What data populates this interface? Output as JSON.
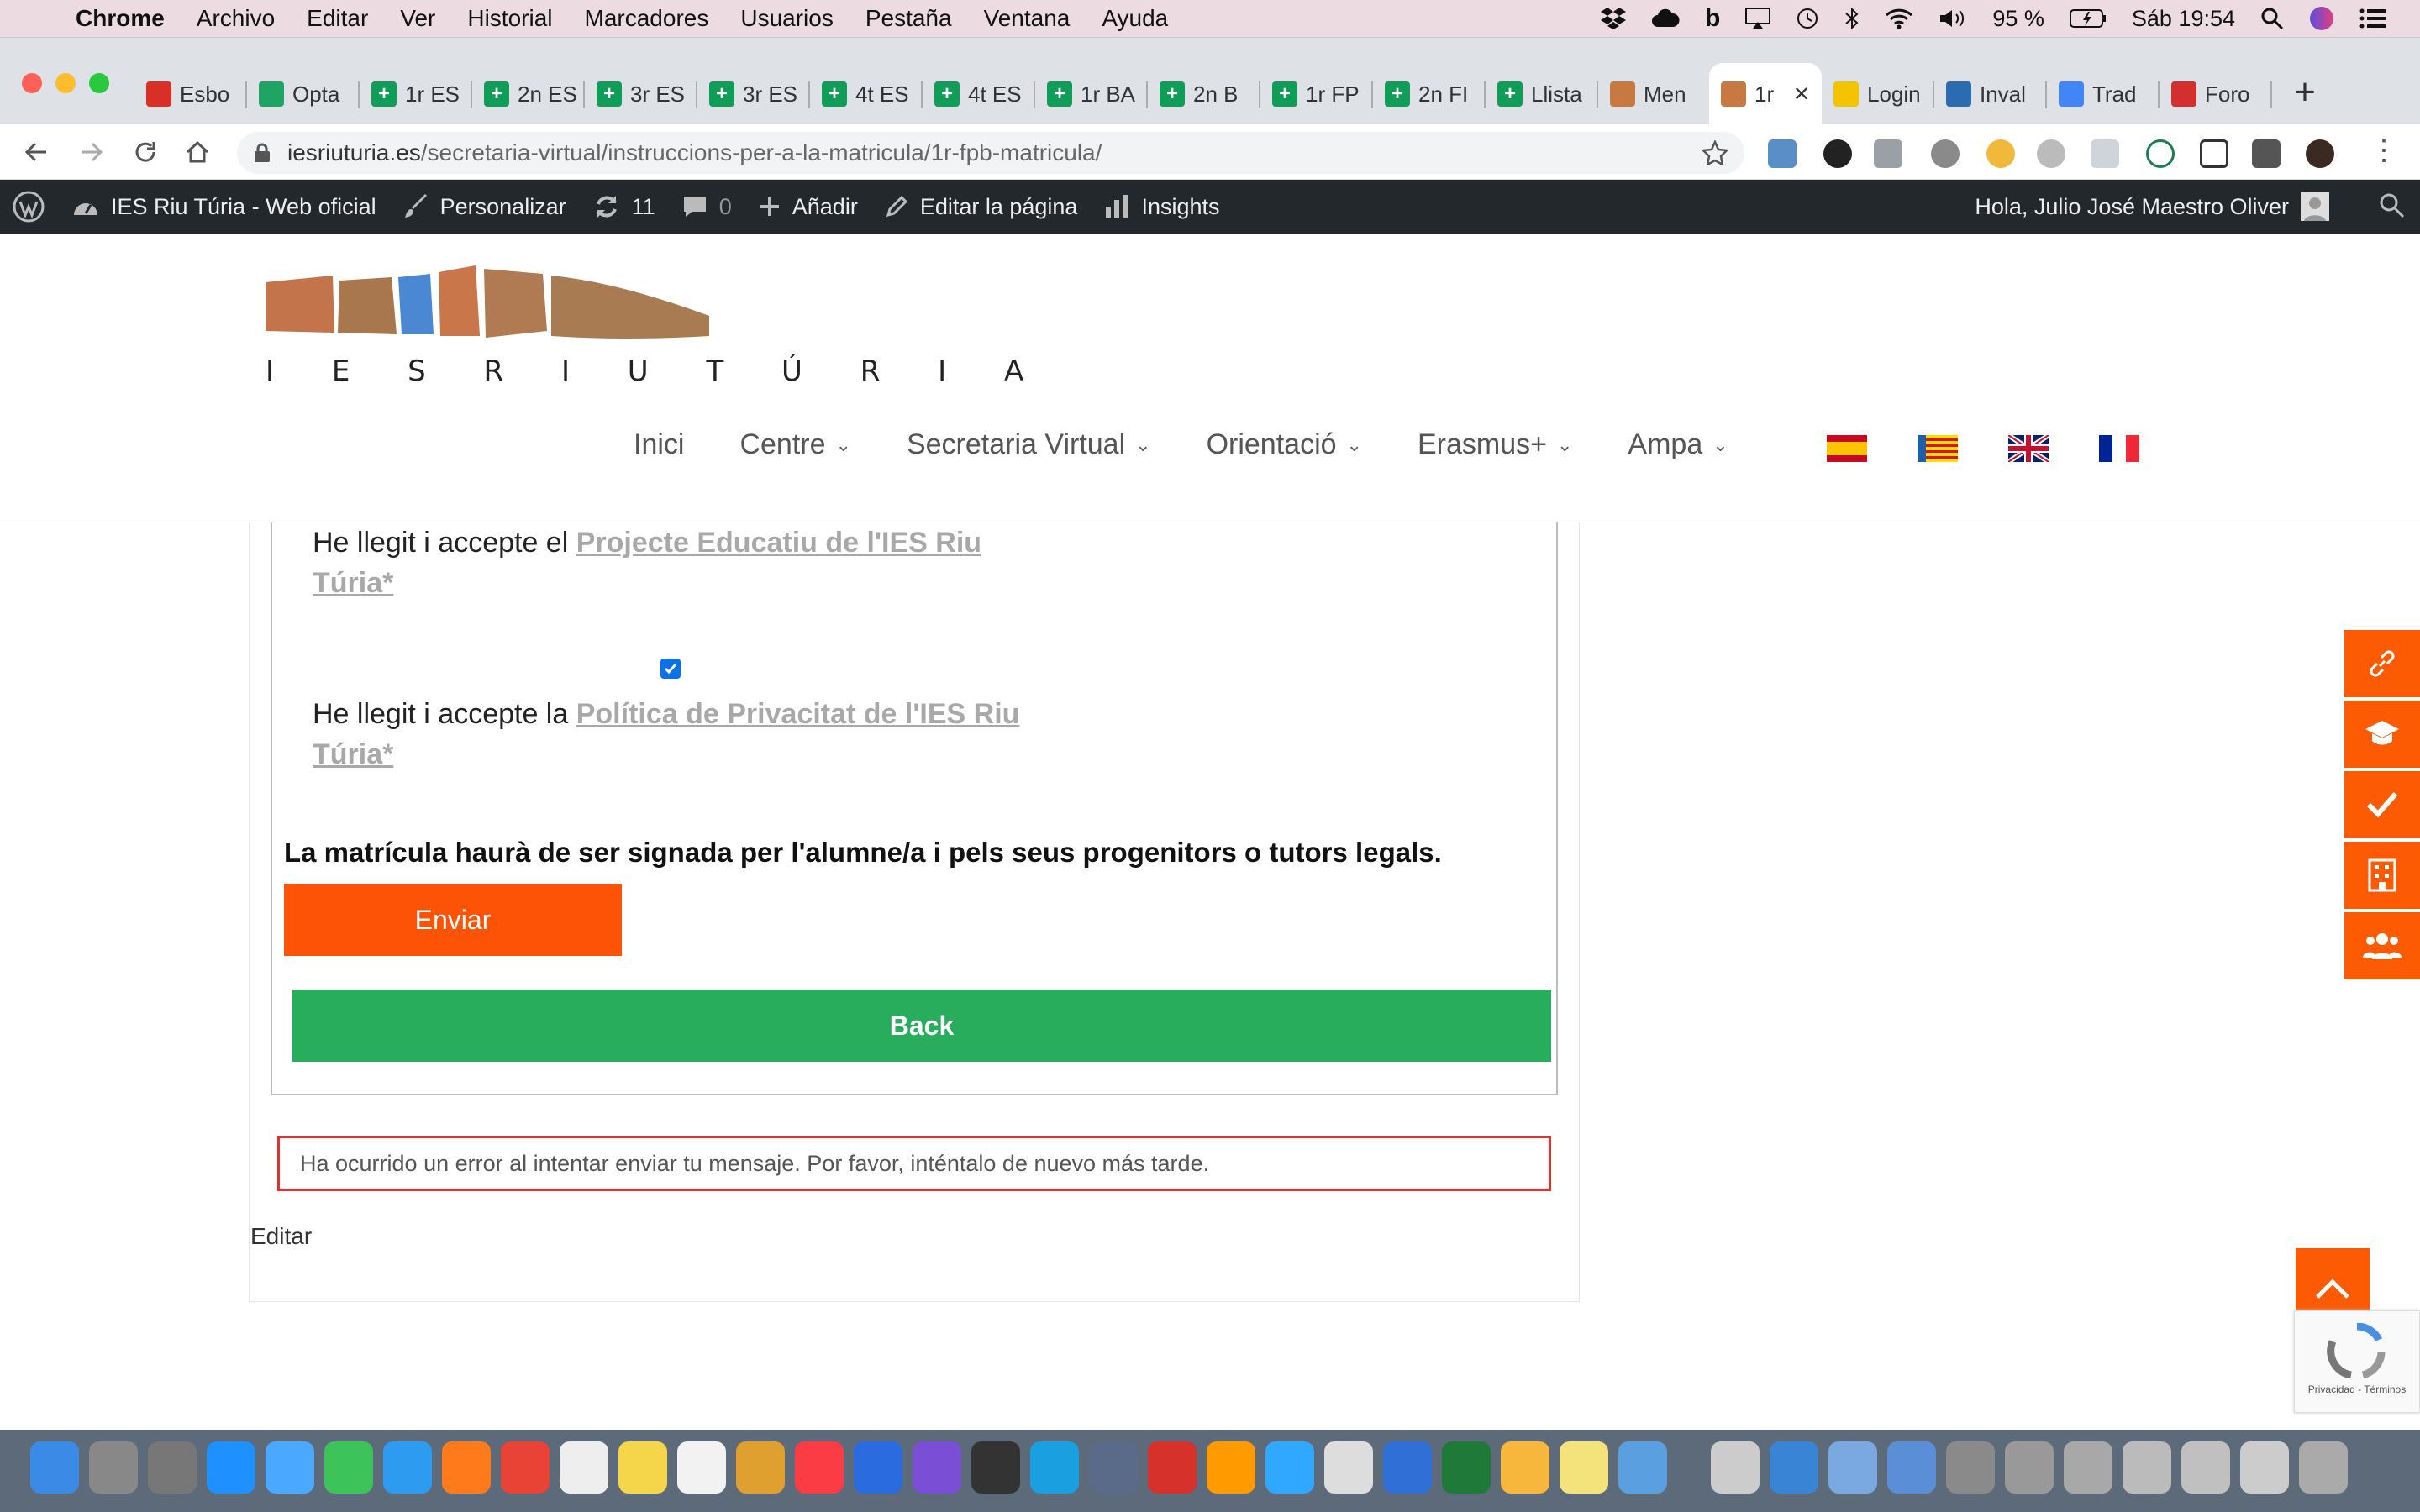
{
  "menubar": {
    "app": "Chrome",
    "menus": [
      "Archivo",
      "Editar",
      "Ver",
      "Historial",
      "Marcadores",
      "Usuarios",
      "Pestaña",
      "Ventana",
      "Ayuda"
    ],
    "battery": "95 %",
    "clock": "Sáb 19:54"
  },
  "tabs": [
    {
      "label": "Esbo",
      "icon": "gmail-icon",
      "color": "#d93025"
    },
    {
      "label": "Opta",
      "icon": "drive-icon",
      "color": "#1fa463"
    },
    {
      "label": "1r ES",
      "icon": "sheets-icon",
      "color": "#0f9d58"
    },
    {
      "label": "2n ES",
      "icon": "sheets-icon",
      "color": "#0f9d58"
    },
    {
      "label": "3r ES",
      "icon": "sheets-icon",
      "color": "#0f9d58"
    },
    {
      "label": "3r ES",
      "icon": "sheets-icon",
      "color": "#0f9d58"
    },
    {
      "label": "4t ES",
      "icon": "sheets-icon",
      "color": "#0f9d58"
    },
    {
      "label": "4t ES",
      "icon": "sheets-icon",
      "color": "#0f9d58"
    },
    {
      "label": "1r BA",
      "icon": "sheets-icon",
      "color": "#0f9d58"
    },
    {
      "label": "2n B",
      "icon": "sheets-icon",
      "color": "#0f9d58"
    },
    {
      "label": "1r FP",
      "icon": "sheets-icon",
      "color": "#0f9d58"
    },
    {
      "label": "2n FI",
      "icon": "sheets-icon",
      "color": "#0f9d58"
    },
    {
      "label": "Llista",
      "icon": "sheets-icon",
      "color": "#0f9d58"
    },
    {
      "label": "Men",
      "icon": "site-icon",
      "color": "#c87941"
    },
    {
      "label": "1r",
      "icon": "site-icon",
      "color": "#c87941",
      "active": true
    },
    {
      "label": "Login",
      "icon": "e-icon",
      "color": "#f5c400"
    },
    {
      "label": "Inval",
      "icon": "mountain-icon",
      "color": "#2b6cb0"
    },
    {
      "label": "Trad",
      "icon": "translate-icon",
      "color": "#4285f4"
    },
    {
      "label": "Foro",
      "icon": "w-icon",
      "color": "#d32f2f"
    }
  ],
  "address": {
    "domain": "iesriuturia.es",
    "path": "/secretaria-virtual/instruccions-per-a-la-matricula/1r-fpb-matricula/"
  },
  "wpbar": {
    "site": "IES Riu Túria - Web oficial",
    "customize": "Personalizar",
    "updates": "11",
    "comments": "0",
    "add": "Añadir",
    "edit_page": "Editar la página",
    "insights": "Insights",
    "greeting": "Hola, Julio José Maestro Oliver"
  },
  "logo": {
    "text": "I E S R I U T Ú R I A"
  },
  "nav": {
    "items": [
      {
        "label": "Inici",
        "dropdown": false
      },
      {
        "label": "Centre",
        "dropdown": true
      },
      {
        "label": "Secretaria Virtual",
        "dropdown": true
      },
      {
        "label": "Orientació",
        "dropdown": true
      },
      {
        "label": "Erasmus+",
        "dropdown": true
      },
      {
        "label": "Ampa",
        "dropdown": true
      }
    ]
  },
  "form": {
    "line1_prefix": "He llegit i accepte el ",
    "line1_link_a": "Projecte Educatiu de l'IES Riu",
    "line1_link_b": "Túria*",
    "line2_prefix": "He llegit i accepte la ",
    "line2_link_a": "Política de Privacitat de l'IES Riu",
    "line2_link_b": "Túria*",
    "privacy_checked": true,
    "notice": "La matrícula haurà de ser signada per l'alumne/a i pels seus progenitors o tutors legals.",
    "submit": "Enviar",
    "back": "Back"
  },
  "error_message": "Ha ocurrido un error al intentar enviar tu mensaje. Por favor, inténtalo de nuevo más tarde.",
  "edit_link": "Editar",
  "recaptcha": {
    "text": "Privacidad - Términos"
  },
  "colors": {
    "orange": "#fd5306",
    "green": "#28ad5c",
    "error_border": "#e0302f",
    "wp_bar": "#23282d"
  }
}
